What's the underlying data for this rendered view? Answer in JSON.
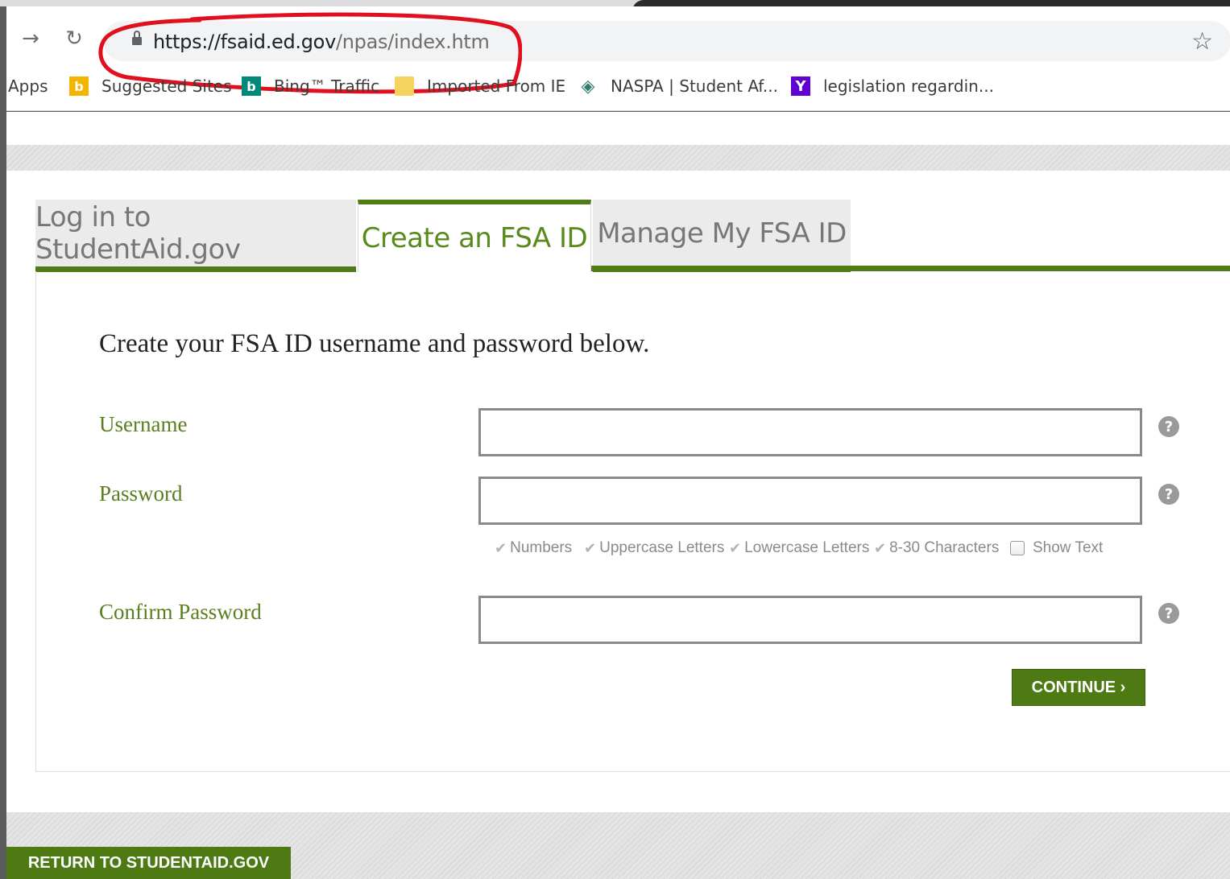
{
  "browser": {
    "url_host": "https://fsaid.ed.gov",
    "url_path": "/npas/index.htm",
    "back_icon": "arrow-right-icon",
    "reload_icon": "reload-icon",
    "star_icon": "star-icon",
    "bookmarks": [
      {
        "label": "Apps"
      },
      {
        "label": "Suggested Sites",
        "icon": "bing-icon",
        "color": "#f4b400"
      },
      {
        "label": "Bing™ Traffic",
        "icon": "bing-icon",
        "color": "#00897b"
      },
      {
        "label": "Imported From IE",
        "icon": "folder-icon",
        "color": "#f6d35f"
      },
      {
        "label": "NASPA | Student Af...",
        "icon": "diamond-icon",
        "color": "#2e7d6e"
      },
      {
        "label": "legislation regardin...",
        "icon": "yahoo-icon",
        "color": "#5f01d1"
      }
    ]
  },
  "tabs": [
    {
      "label": "Log in to StudentAid.gov",
      "active": false
    },
    {
      "label": "Create an FSA ID",
      "active": true
    },
    {
      "label": "Manage My FSA ID",
      "active": false
    }
  ],
  "form": {
    "heading": "Create your FSA ID username and password below.",
    "username_label": "Username",
    "password_label": "Password",
    "confirm_label": "Confirm Password",
    "requirements": [
      "Numbers",
      "Uppercase Letters",
      "Lowercase Letters",
      "8-30 Characters"
    ],
    "show_text_label": "Show Text",
    "continue_label": "CONTINUE ›"
  },
  "footer": {
    "return_label": "RETURN TO STUDENTAID.GOV"
  },
  "colors": {
    "brand_green": "#4d7a13",
    "label_green": "#5a7f1e",
    "annotation_red": "#e0101e"
  }
}
